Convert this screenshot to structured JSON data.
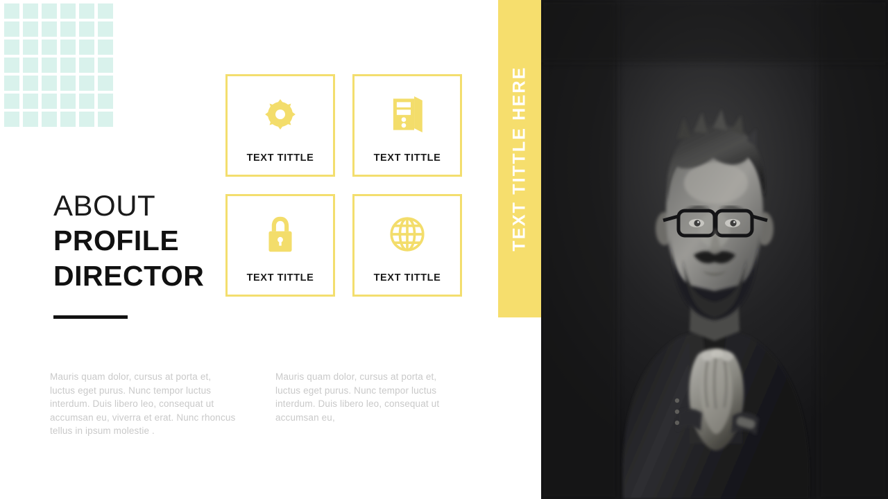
{
  "slide": {
    "background_color": "#ffffff",
    "accent_yellow": "#f6de6d",
    "mint_color": "#d9f2ec",
    "dark_panel_color": "#1b1b1d"
  },
  "decor": {
    "dot_grid": {
      "name": "dot-grid-pattern",
      "columns": 6,
      "rows": 7,
      "color": "#d9f2ec"
    },
    "title_rule_color": "#111111"
  },
  "headline": {
    "line1": "ABOUT",
    "line2": "PROFILE",
    "line3": "DIRECTOR"
  },
  "body": {
    "paragraph1": "Mauris quam dolor, cursus at porta et, luctus eget purus. Nunc tempor luctus interdum. Duis libero leo, consequat ut accumsan eu, viverra et erat. Nunc rhoncus tellus in ipsum molestie .",
    "paragraph2": "Mauris quam dolor, cursus at porta et, luctus eget purus. Nunc tempor luctus interdum. Duis libero leo, consequat ut accumsan eu,"
  },
  "features": [
    {
      "icon": "gear-icon",
      "label": "TEXT TITTLE"
    },
    {
      "icon": "server-tower-icon",
      "label": "TEXT TITTLE"
    },
    {
      "icon": "lock-icon",
      "label": "TEXT TITTLE"
    },
    {
      "icon": "globe-icon",
      "label": "TEXT TITTLE"
    }
  ],
  "side_banner": {
    "text": "TEXT TITTLE HERE",
    "background_color": "#f6de6d",
    "text_color": "#ffffff"
  },
  "portrait": {
    "name": "portrait-photo",
    "description": "Black and white photo of a bearded man with glasses in a dark suit, hands clasped"
  }
}
